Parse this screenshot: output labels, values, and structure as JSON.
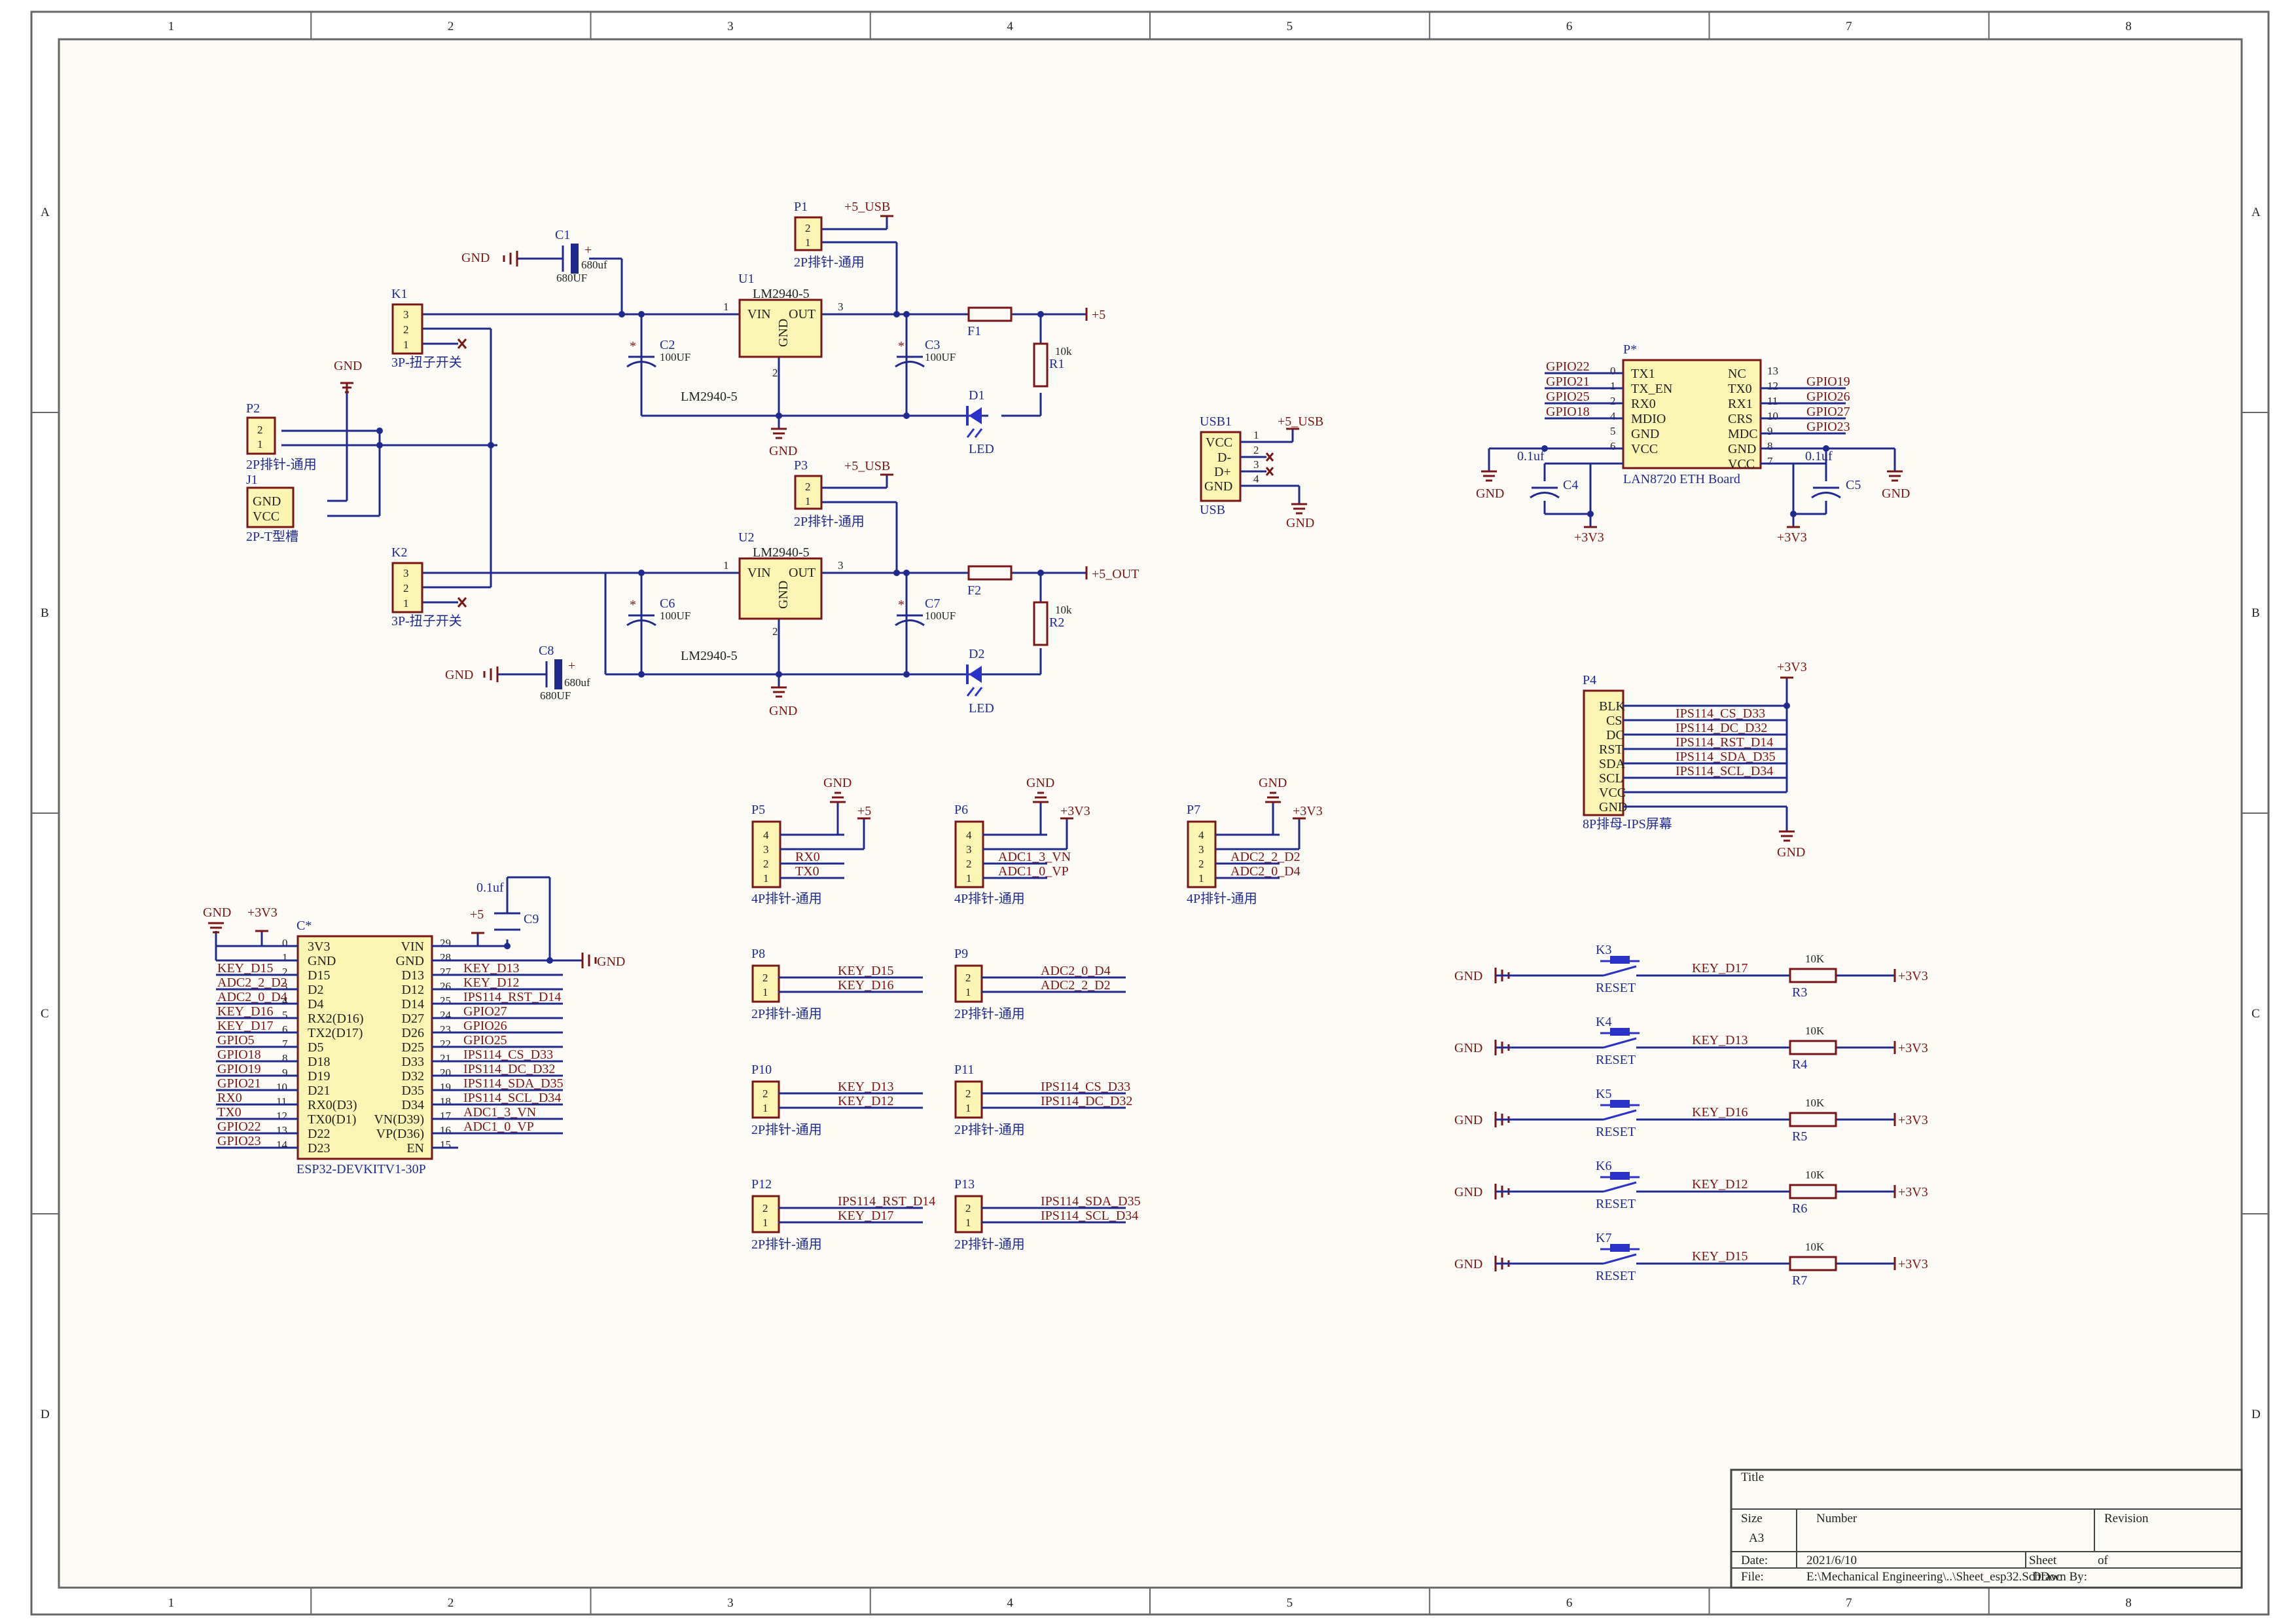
{
  "frame": {
    "columns": [
      "1",
      "2",
      "3",
      "4",
      "5",
      "6",
      "7",
      "8"
    ],
    "rows": [
      "A",
      "B",
      "C",
      "D"
    ]
  },
  "title_block": {
    "title_label": "Title",
    "size_label": "Size",
    "size_value": "A3",
    "number_label": "Number",
    "revision_label": "Revision",
    "date_label": "Date:",
    "date_value": "2021/6/10",
    "sheet_label": "Sheet",
    "of_label": "of",
    "file_label": "File:",
    "file_value": "E:\\Mechanical Engineering\\..\\Sheet_esp32.SchDoc",
    "drawn_by_label": "Drawn By:"
  },
  "power": {
    "u1": {
      "ref": "U1",
      "part": "LM2940-5",
      "vin": "VIN",
      "out": "OUT",
      "gnd": "GND",
      "pin1": "1",
      "pin2": "2",
      "pin3": "3",
      "caption": "LM2940-5"
    },
    "u2": {
      "ref": "U2",
      "part": "LM2940-5",
      "vin": "VIN",
      "out": "OUT",
      "gnd": "GND",
      "pin1": "1",
      "pin2": "2",
      "pin3": "3",
      "caption": "LM2940-5"
    },
    "c1": {
      "ref": "C1",
      "value": "680uf",
      "caption": "680UF"
    },
    "c8": {
      "ref": "C8",
      "value": "680uf",
      "caption": "680UF"
    },
    "c2": {
      "ref": "C2",
      "value": "100UF"
    },
    "c3": {
      "ref": "C3",
      "value": "100UF"
    },
    "c6": {
      "ref": "C6",
      "value": "100UF"
    },
    "c7": {
      "ref": "C7",
      "value": "100UF"
    },
    "f1": "F1",
    "f2": "F2",
    "r1": {
      "ref": "R1",
      "value": "10k"
    },
    "r2": {
      "ref": "R2",
      "value": "10k"
    },
    "d1": {
      "ref": "D1",
      "caption": "LED"
    },
    "d2": {
      "ref": "D2",
      "caption": "LED"
    },
    "k1": {
      "ref": "K1",
      "caption": "3P-扭子开关",
      "pins": [
        "3",
        "2",
        "1"
      ]
    },
    "k2": {
      "ref": "K2",
      "caption": "3P-扭子开关",
      "pins": [
        "3",
        "2",
        "1"
      ]
    },
    "p1": {
      "ref": "P1",
      "caption": "2P排针-通用",
      "pins": [
        "2",
        "1"
      ],
      "net": "+5_USB"
    },
    "p2": {
      "ref": "P2",
      "caption": "2P排针-通用",
      "pins": [
        "2",
        "1"
      ]
    },
    "p3": {
      "ref": "P3",
      "caption": "2P排针-通用",
      "pins": [
        "2",
        "1"
      ],
      "net": "+5_USB"
    },
    "j1": {
      "ref": "J1",
      "caption": "2P-T型槽",
      "pins": [
        "GND",
        "VCC"
      ]
    },
    "out_top": "+5",
    "out_bottom": "+5_OUT",
    "gnd": "GND"
  },
  "usb": {
    "ref": "USB1",
    "caption": "USB",
    "pins": [
      "VCC",
      "D-",
      "D+",
      "GND"
    ],
    "nums": [
      "1",
      "2",
      "3",
      "4"
    ],
    "net": "+5_USB",
    "gnd": "GND"
  },
  "lan": {
    "ref": "P*",
    "caption": "LAN8720 ETH Board",
    "left_pins": [
      "TX1",
      "TX_EN",
      "RX0",
      "MDIO",
      "GND",
      "VCC"
    ],
    "left_nums": [
      "0",
      "1",
      "2",
      "4",
      "5",
      "6"
    ],
    "left_nets": [
      "GPIO22",
      "GPIO21",
      "GPIO25",
      "GPIO18"
    ],
    "right_pins": [
      "NC",
      "TX0",
      "RX1",
      "CRS",
      "MDC",
      "GND",
      "VCC"
    ],
    "right_nums": [
      "13",
      "12",
      "11",
      "10",
      "9",
      "8",
      "7"
    ],
    "right_nets": [
      "GPIO19",
      "GPIO26",
      "GPIO27",
      "GPIO23"
    ],
    "c4": {
      "ref": "C4",
      "value": "0.1uf"
    },
    "c5": {
      "ref": "C5",
      "value": "0.1uf"
    },
    "v33": "+3V3",
    "gnd": "GND"
  },
  "lcd": {
    "ref": "P4",
    "caption": "8P排母-IPS屏幕",
    "pins": [
      "BLK",
      "CS",
      "DC",
      "RST",
      "SDA",
      "SCL",
      "VCC",
      "GND"
    ],
    "nets": [
      "IPS114_CS_D33",
      "IPS114_DC_D32",
      "IPS114_RST_D14",
      "IPS114_SDA_D35",
      "IPS114_SCL_D34"
    ],
    "v33": "+3V3",
    "gnd": "GND"
  },
  "headers4": [
    {
      "ref": "P5",
      "caption": "4P排针-通用",
      "pins": [
        "4",
        "3",
        "2",
        "1"
      ],
      "nets": [
        "RX0",
        "TX0"
      ],
      "top_gnd": "GND",
      "top_v": "+5"
    },
    {
      "ref": "P6",
      "caption": "4P排针-通用",
      "pins": [
        "4",
        "3",
        "2",
        "1"
      ],
      "nets": [
        "ADC1_3_VN",
        "ADC1_0_VP"
      ],
      "top_gnd": "GND",
      "top_v": "+3V3"
    },
    {
      "ref": "P7",
      "caption": "4P排针-通用",
      "pins": [
        "4",
        "3",
        "2",
        "1"
      ],
      "nets": [
        "ADC2_2_D2",
        "ADC2_0_D4"
      ],
      "top_gnd": "GND",
      "top_v": "+3V3"
    }
  ],
  "headers2": [
    {
      "ref": "P8",
      "caption": "2P排针-通用",
      "pins": [
        "2",
        "1"
      ],
      "nets": [
        "KEY_D15",
        "KEY_D16"
      ]
    },
    {
      "ref": "P9",
      "caption": "2P排针-通用",
      "pins": [
        "2",
        "1"
      ],
      "nets": [
        "ADC2_0_D4",
        "ADC2_2_D2"
      ]
    },
    {
      "ref": "P10",
      "caption": "2P排针-通用",
      "pins": [
        "2",
        "1"
      ],
      "nets": [
        "KEY_D13",
        "KEY_D12"
      ]
    },
    {
      "ref": "P11",
      "caption": "2P排针-通用",
      "pins": [
        "2",
        "1"
      ],
      "nets": [
        "IPS114_CS_D33",
        "IPS114_DC_D32"
      ]
    },
    {
      "ref": "P12",
      "caption": "2P排针-通用",
      "pins": [
        "2",
        "1"
      ],
      "nets": [
        "IPS114_RST_D14",
        "KEY_D17"
      ]
    },
    {
      "ref": "P13",
      "caption": "2P排针-通用",
      "pins": [
        "2",
        "1"
      ],
      "nets": [
        "IPS114_SDA_D35",
        "IPS114_SCL_D34"
      ]
    }
  ],
  "esp32": {
    "ref": "C*",
    "caption": "ESP32-DEVKITV1-30P",
    "left_names": [
      "3V3",
      "GND",
      "D15",
      "D2",
      "D4",
      "RX2(D16)",
      "TX2(D17)",
      "D5",
      "D18",
      "D19",
      "D21",
      "RX0(D3)",
      "TX0(D1)",
      "D22",
      "D23"
    ],
    "left_nums": [
      "0",
      "1",
      "2",
      "3",
      "4",
      "5",
      "6",
      "7",
      "8",
      "9",
      "10",
      "11",
      "12",
      "13",
      "14"
    ],
    "left_nets": [
      "",
      "",
      "KEY_D15",
      "ADC2_2_D2",
      "ADC2_0_D4",
      "KEY_D16",
      "KEY_D17",
      "GPIO5",
      "GPIO18",
      "GPIO19",
      "GPIO21",
      "RX0",
      "TX0",
      "GPIO22",
      "GPIO23"
    ],
    "right_names": [
      "VIN",
      "GND",
      "D13",
      "D12",
      "D14",
      "D27",
      "D26",
      "D25",
      "D33",
      "D32",
      "D35",
      "D34",
      "VN(D39)",
      "VP(D36)",
      "EN"
    ],
    "right_nums": [
      "29",
      "28",
      "27",
      "26",
      "25",
      "24",
      "23",
      "22",
      "21",
      "20",
      "19",
      "18",
      "17",
      "16",
      "15"
    ],
    "right_nets": [
      "",
      "",
      "KEY_D13",
      "KEY_D12",
      "IPS114_RST_D14",
      "GPIO27",
      "GPIO26",
      "GPIO25",
      "IPS114_CS_D33",
      "IPS114_DC_D32",
      "IPS114_SDA_D35",
      "IPS114_SCL_D34",
      "ADC1_3_VN",
      "ADC1_0_VP",
      ""
    ],
    "c9": {
      "ref": "C9",
      "value": "0.1uf"
    },
    "gnd": "GND",
    "v33": "+3V3",
    "v5": "+5"
  },
  "buttons": [
    {
      "ref": "K3",
      "caption": "RESET",
      "net": "KEY_D17",
      "r": "R3",
      "rv": "10K",
      "gnd": "GND",
      "v": "+3V3"
    },
    {
      "ref": "K4",
      "caption": "RESET",
      "net": "KEY_D13",
      "r": "R4",
      "rv": "10K",
      "gnd": "GND",
      "v": "+3V3"
    },
    {
      "ref": "K5",
      "caption": "RESET",
      "net": "KEY_D16",
      "r": "R5",
      "rv": "10K",
      "gnd": "GND",
      "v": "+3V3"
    },
    {
      "ref": "K6",
      "caption": "RESET",
      "net": "KEY_D12",
      "r": "R6",
      "rv": "10K",
      "gnd": "GND",
      "v": "+3V3"
    },
    {
      "ref": "K7",
      "caption": "RESET",
      "net": "KEY_D15",
      "r": "R7",
      "rv": "10K",
      "gnd": "GND",
      "v": "+3V3"
    }
  ]
}
